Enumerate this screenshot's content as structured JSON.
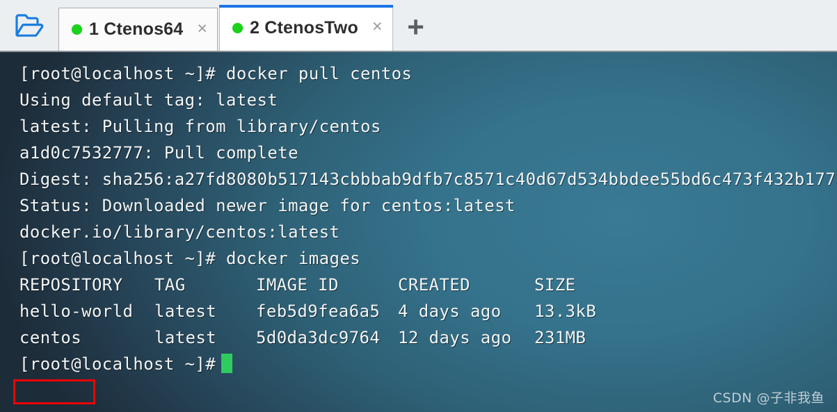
{
  "tabbar": {
    "folder_icon": "open-folder-icon",
    "new_tab_label": "+",
    "close_glyph": "×",
    "tabs": [
      {
        "label": "1 Ctenos64",
        "status": "connected",
        "active": false
      },
      {
        "label": "2 CtenosTwo",
        "status": "connected",
        "active": true
      }
    ],
    "colors": {
      "active_tab_accent": "#1a73e8",
      "status_dot": "#19d219",
      "bar_background": "#eceff1",
      "folder_icon": "#1a7ee0"
    }
  },
  "terminal": {
    "colors": {
      "background": "#35728c",
      "text": "#f2f5f6",
      "cursor": "#2ecc5f",
      "highlight_box": "#f50000"
    },
    "lines": [
      "[root@localhost ~]# docker pull centos",
      "Using default tag: latest",
      "latest: Pulling from library/centos",
      "a1d0c7532777: Pull complete",
      "Digest: sha256:a27fd8080b517143cbbbab9dfb7c8571c40d67d534bbdee55bd6c473f432b177",
      "Status: Downloaded newer image for centos:latest",
      "docker.io/library/centos:latest",
      "[root@localhost ~]# docker images"
    ],
    "table": {
      "headers": [
        "REPOSITORY",
        "TAG",
        "IMAGE ID",
        "CREATED",
        "SIZE"
      ],
      "rows": [
        {
          "repository": "hello-world",
          "tag": "latest",
          "image_id": "feb5d9fea6a5",
          "created": "4 days ago",
          "size": "13.3kB"
        },
        {
          "repository": "centos",
          "tag": "latest",
          "image_id": "5d0da3dc9764",
          "created": "12 days ago",
          "size": "231MB"
        }
      ],
      "highlighted_cell": "centos"
    },
    "prompt": "[root@localhost ~]#"
  },
  "watermark": "CSDN @子非我鱼"
}
